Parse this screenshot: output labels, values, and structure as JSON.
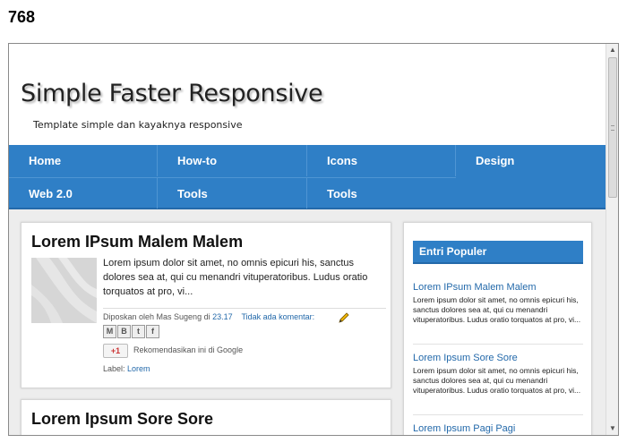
{
  "caption": "768",
  "header": {
    "title": "Simple Faster Responsive",
    "description": "Template simple dan kayaknya responsive"
  },
  "nav": {
    "row1": [
      "Home",
      "How-to",
      "Icons",
      "Design"
    ],
    "row2": [
      "Web 2.0",
      "Tools",
      "Tools"
    ]
  },
  "posts": [
    {
      "title": "Lorem IPsum Malem Malem",
      "snippet": "Lorem ipsum dolor sit amet, no omnis epicuri his, sanctus dolores sea at, qui cu menandri vituperatoribus. Ludus oratio torquatos at pro, vi...",
      "posted_by": "Diposkan oleh Mas Sugeng di",
      "time": "23.17",
      "comments": "Tidak ada komentar:",
      "share_buttons": [
        "M",
        "B",
        "t",
        "f"
      ],
      "gplus": "+1",
      "recommend": "Rekomendasikan ini di Google",
      "label_prefix": "Label:",
      "label": "Lorem"
    },
    {
      "title": "Lorem Ipsum Sore Sore"
    }
  ],
  "sidebar": {
    "widget_title": "Entri Populer",
    "items": [
      {
        "title": "Lorem IPsum Malem Malem",
        "text": "Lorem ipsum dolor sit amet, no omnis epicuri his, sanctus dolores sea at, qui cu menandri vituperatoribus. Ludus oratio torquatos at pro, vi..."
      },
      {
        "title": "Lorem Ipsum Sore Sore",
        "text": "Lorem ipsum dolor sit amet, no omnis epicuri his, sanctus dolores sea at, qui cu menandri vituperatoribus. Ludus oratio torquatos at pro, vi..."
      },
      {
        "title": "Lorem Ipsum Pagi Pagi",
        "text": ""
      }
    ]
  },
  "colors": {
    "accent": "#2f7fc6",
    "accent_dark": "#2369aa",
    "link": "#2369aa"
  }
}
